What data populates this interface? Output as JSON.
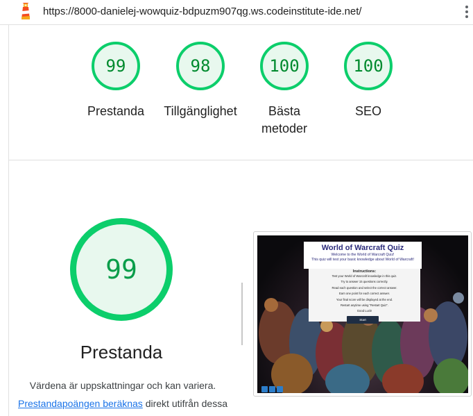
{
  "browser": {
    "url": "https://8000-danielej-wowquiz-bdpuzm907qg.ws.codeinstitute-ide.net/",
    "logo_icon": "lighthouse-icon",
    "menu_icon": "more-vert-icon"
  },
  "summary_gauges": [
    {
      "score": "99",
      "label": "Prestanda"
    },
    {
      "score": "98",
      "label": "Tillgänglighet"
    },
    {
      "score": "100",
      "label": "Bästa metoder"
    },
    {
      "score": "100",
      "label": "SEO"
    }
  ],
  "performance": {
    "score": "99",
    "title": "Prestanda",
    "description_line1": "Värdena är uppskattningar och kan variera.",
    "link_text": "Prestandapoängen beräknas",
    "description_line2_rest": " direkt utifrån dessa"
  },
  "screenshot": {
    "title": "World of Warcraft Quiz",
    "subtitle1": "Welcome to the World of Warcraft Quiz!",
    "subtitle2": "This quiz will test your basic knowledge about World of Warcraft!",
    "instructions_heading": "Instructions:",
    "instructions": [
      "Test your World of Warcraft knowledge in this quiz.",
      "Try to answer 15 questions correctly.",
      "Read each question and select the correct answer.",
      "Earn one point for each correct answer.",
      "Your final score will be displayed at the end.",
      "Restart anytime using \"Restart Quiz\".",
      "Good Luck!"
    ],
    "start_label": "Start"
  },
  "colors": {
    "pass_green": "#0cce6b",
    "pass_fill": "#e8f8ee",
    "score_text": "#008a2e",
    "link_blue": "#1a73e8"
  }
}
